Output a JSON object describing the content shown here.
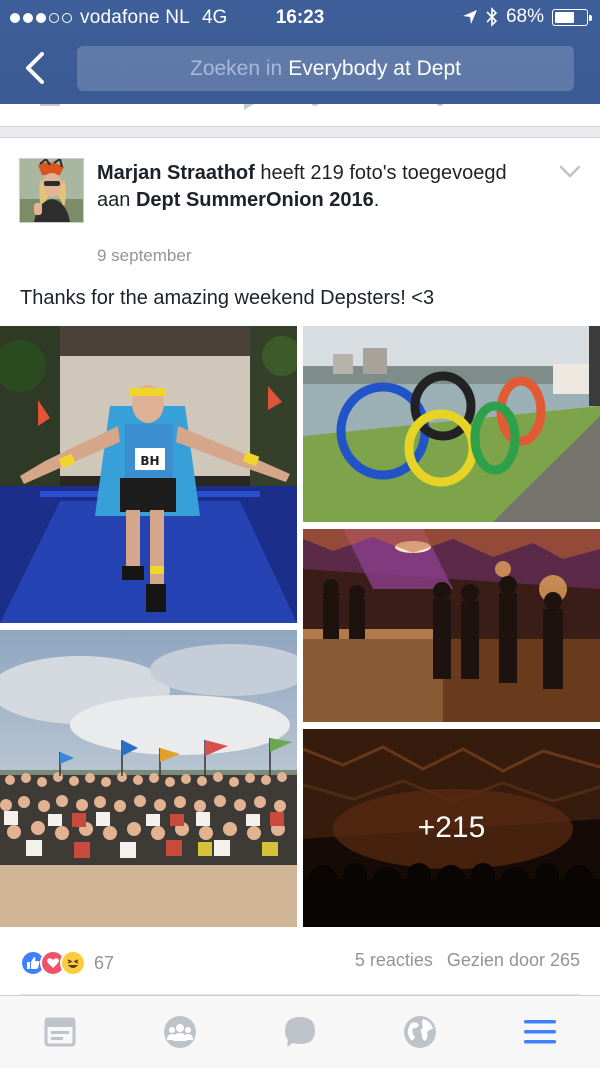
{
  "status": {
    "carrier": "vodafone NL",
    "network": "4G",
    "time": "16:23",
    "battery": "68%",
    "battery_level": 0.68
  },
  "nav": {
    "search_placeholder": "Zoeken in",
    "search_group": "Everybody at Dept"
  },
  "post": {
    "author": "Marjan Straathof",
    "action": " heeft 219 foto's toegevoegd aan ",
    "album": "Dept SummerOnion 2016",
    "album_suffix": ".",
    "date": "9 september",
    "caption": "Thanks for the amazing weekend Depsters! <3",
    "more_photos": "+215",
    "reactions_count": "67",
    "comments": "5 reacties",
    "seen_by": "Gezien door 265"
  },
  "tabs": [
    "news-feed",
    "groups",
    "messenger",
    "notifications",
    "menu"
  ],
  "colors": {
    "brand": "#3b5998",
    "like": "#4080ff",
    "love": "#f25268",
    "haha": "#fbcd3d",
    "active_tab": "#4080ff",
    "inactive_tab": "#bec2c9"
  }
}
